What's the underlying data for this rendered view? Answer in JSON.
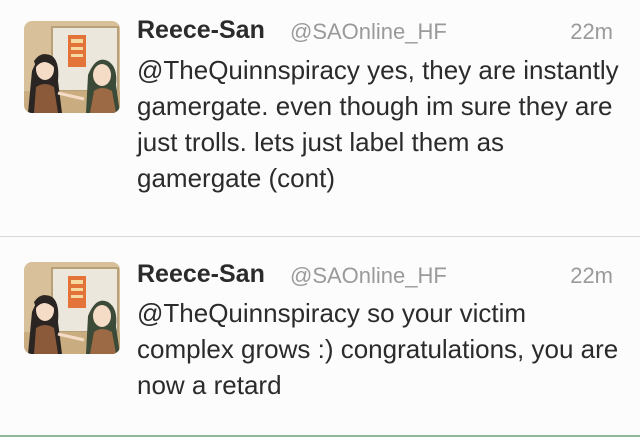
{
  "tweets": [
    {
      "name": "Reece-San",
      "handle": "@SAOnline_HF",
      "time": "22m",
      "mention": "@TheQuinnspiracy",
      "text": " yes, they are instantly gamergate. even though im sure they are just trolls. lets just label them as gamergate (cont)"
    },
    {
      "name": "Reece-San",
      "handle": "@SAOnline_HF",
      "time": "22m",
      "mention": "@TheQuinnspiracy",
      "text": " so your victim complex grows :) congratulations, you are now a retard"
    }
  ]
}
